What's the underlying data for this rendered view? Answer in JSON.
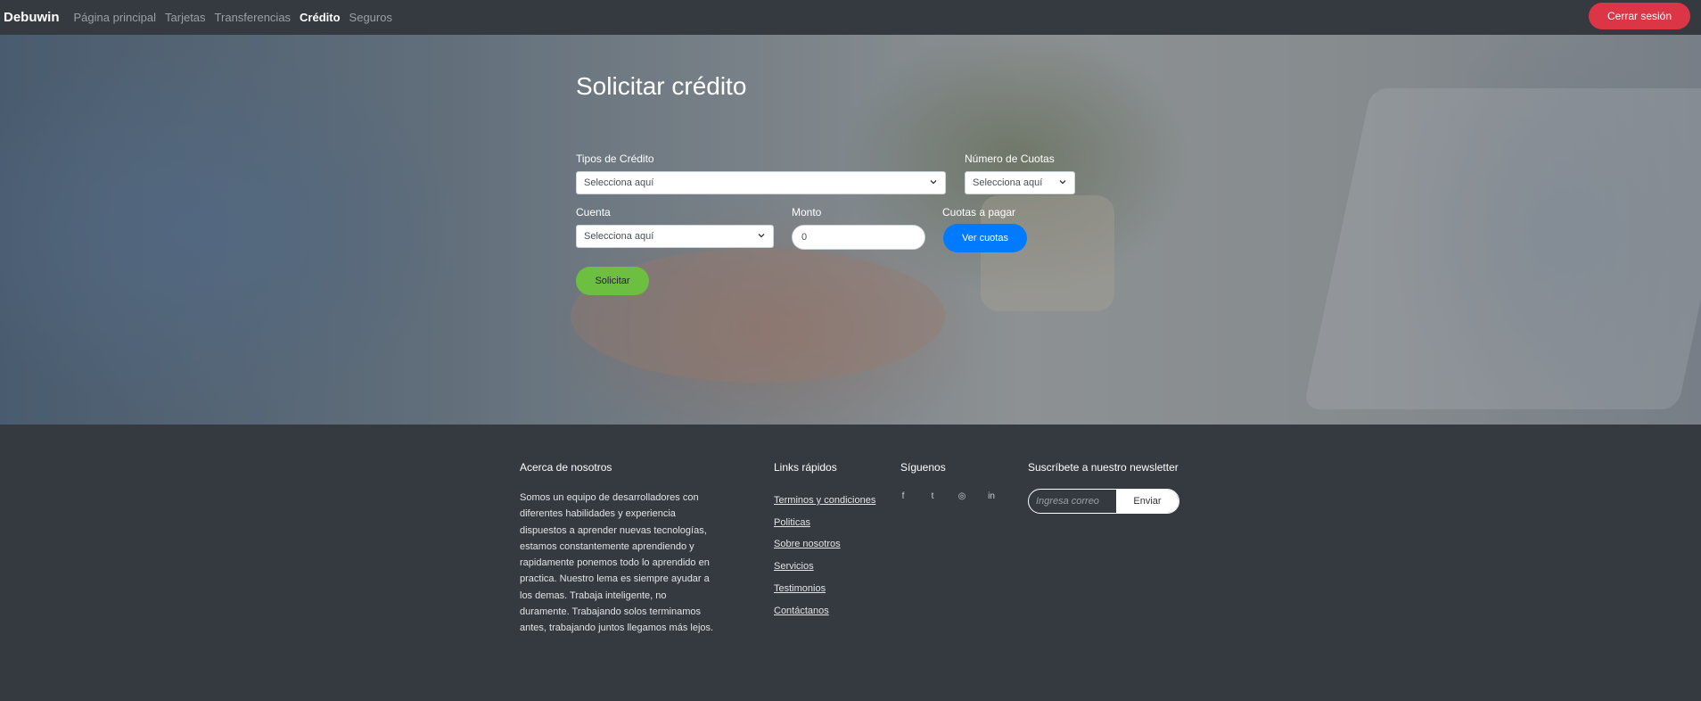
{
  "navbar": {
    "brand": "Debuwin",
    "links": [
      {
        "label": "Página principal",
        "active": false
      },
      {
        "label": "Tarjetas",
        "active": false
      },
      {
        "label": "Transferencias",
        "active": false
      },
      {
        "label": "Crédito",
        "active": true
      },
      {
        "label": "Seguros",
        "active": false
      }
    ],
    "logout_label": "Cerrar sesión"
  },
  "form": {
    "title": "Solicitar crédito",
    "tipos_credito": {
      "label": "Tipos de Crédito",
      "value": "Selecciona aquí"
    },
    "numero_cuotas": {
      "label": "Número de Cuotas",
      "value": "Selecciona aquí"
    },
    "cuenta": {
      "label": "Cuenta",
      "value": "Selecciona aquí"
    },
    "monto": {
      "label": "Monto",
      "value": "0"
    },
    "cuotas_pagar": {
      "label": "Cuotas a pagar",
      "button": "Ver cuotas"
    },
    "submit_label": "Solicitar"
  },
  "footer": {
    "about": {
      "heading": "Acerca de nosotros",
      "text": "Somos un equipo de desarrolladores con diferentes habilidades y experiencia dispuestos a aprender nuevas tecnologías, estamos constantemente aprendiendo y rapidamente ponemos todo lo aprendido en practica. Nuestro lema es siempre ayudar a los demas. Trabaja inteligente, no duramente. Trabajando solos terminamos antes, trabajando juntos llegamos más lejos."
    },
    "links": {
      "heading": "Links rápidos",
      "items": [
        "Terminos y condiciones",
        "Politicas",
        "Sobre nosotros",
        "Servicios",
        "Testimonios",
        "Contáctanos"
      ]
    },
    "social": {
      "heading": "Síguenos",
      "icons": [
        "facebook-icon",
        "twitter-icon",
        "instagram-icon",
        "linkedin-icon"
      ],
      "glyphs": [
        "f",
        "t",
        "◎",
        "in"
      ]
    },
    "newsletter": {
      "heading": "Suscríbete a nuestro newsletter",
      "placeholder": "Ingresa correo",
      "button": "Enviar"
    }
  },
  "colors": {
    "navbar_bg": "#343a40",
    "logout": "#dc3545",
    "primary": "#007bff",
    "success": "#6cbf40"
  }
}
